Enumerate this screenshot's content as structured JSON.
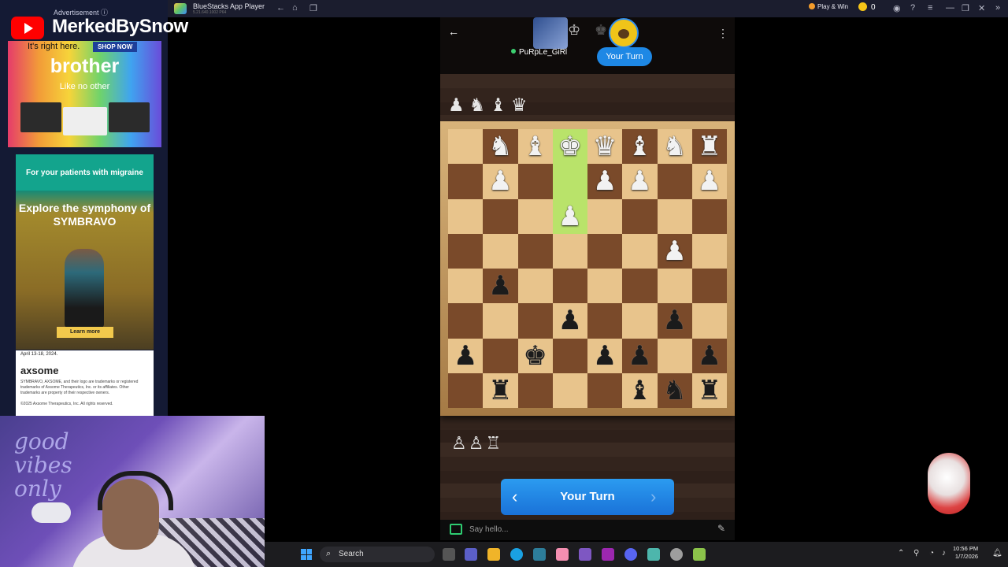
{
  "bluestacks": {
    "app_title": "BlueStacks App Player",
    "app_subtitle": "5.21.640.1002 P64",
    "play_win_label": "Play & Win",
    "coin_count": "0"
  },
  "stream_overlay": {
    "channel_name": "MerkedBySnow"
  },
  "ads": {
    "label": "Advertisement ⓘ",
    "brother": {
      "tagline": "It's right here.",
      "shop_label": "SHOP NOW",
      "logo": "brother",
      "motto": "Like no other"
    },
    "symbravo": {
      "header": "For your patients with migraine",
      "headline": "Explore the symphony of SYMBRAVO",
      "cta": "Learn more"
    },
    "axsome": {
      "date": "April 13-18, 2024.",
      "logo": "axsome",
      "legal": "SYMBRAVO, AXSOME, and their logo are trademarks or registered trademarks of Axsome Therapeutics, Inc. or its affiliates. Other trademarks are property of their respective owners.",
      "copyright": "©2025 Axsome Therapeutics, Inc. All rights reserved."
    }
  },
  "webcam": {
    "neon_text": "good vibes only"
  },
  "game": {
    "opponent_name": "PuRpLe_GiRl",
    "turn_pill": "Your Turn",
    "turn_button": "Your Turn",
    "chat_placeholder": "Say hello...",
    "captured_top": "♟♞♝♛",
    "captured_bottom": "♙♙♖",
    "highlight_squares": [
      [
        0,
        3
      ],
      [
        1,
        3
      ],
      [
        2,
        3
      ]
    ],
    "board": [
      [
        "",
        "wN",
        "wB",
        "wK",
        "wQ",
        "wB",
        "wN",
        "wR"
      ],
      [
        "",
        "wP",
        "",
        "",
        "wP",
        "wP",
        "",
        "wP"
      ],
      [
        "",
        "",
        "",
        "wP",
        "",
        "",
        "",
        ""
      ],
      [
        "",
        "",
        "",
        "",
        "",
        "",
        "wP",
        ""
      ],
      [
        "",
        "bP",
        "",
        "",
        "",
        "",
        "",
        ""
      ],
      [
        "",
        "",
        "",
        "bP",
        "",
        "",
        "bP",
        ""
      ],
      [
        "bP",
        "",
        "bK",
        "",
        "bP",
        "bP",
        "",
        "bP"
      ],
      [
        "",
        "bR",
        "",
        "",
        "",
        "bB",
        "bN",
        "bR"
      ]
    ]
  },
  "taskbar": {
    "search_label": "Search",
    "time": "10:56 PM",
    "date": "1/7/2026"
  },
  "colors": {
    "accent_blue": "#1e88e5",
    "board_light": "#e8c48c",
    "board_dark": "#7a4a2a",
    "highlight": "#b9e36a",
    "youtube_red": "#ff0000"
  }
}
